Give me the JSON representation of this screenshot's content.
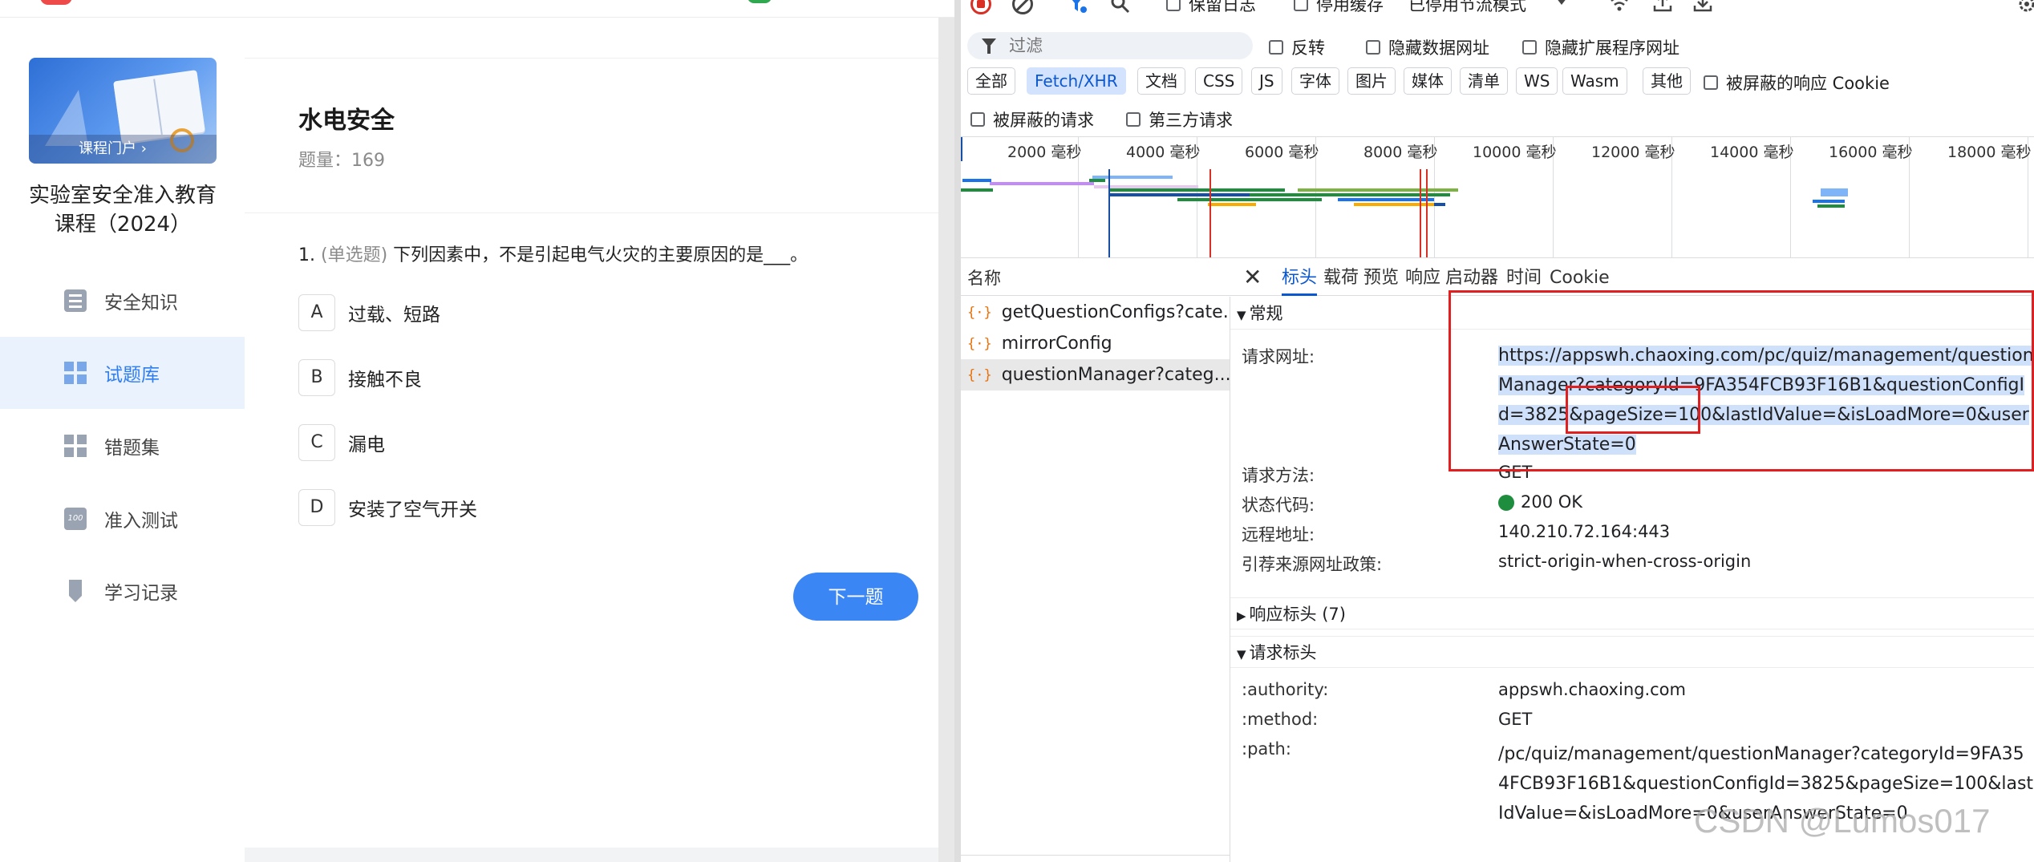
{
  "app": {
    "banner_label": "课程门户 ›",
    "course_title": "实验室安全准入教育课程（2024）",
    "nav": [
      {
        "label": "安全知识",
        "icon": "list-icon"
      },
      {
        "label": "试题库",
        "icon": "grid-icon"
      },
      {
        "label": "错题集",
        "icon": "grid-icon"
      },
      {
        "label": "准入测试",
        "icon": "score-icon"
      },
      {
        "label": "学习记录",
        "icon": "record-icon"
      }
    ],
    "active_nav": "试题库",
    "bank_title": "水电安全",
    "count_label": "题量：",
    "count_value": "169",
    "question": {
      "number": "1.",
      "type": "(单选题)",
      "text": "下列因素中，不是引起电气火灾的主要原因的是___。"
    },
    "options": [
      {
        "letter": "A",
        "text": "过载、短路"
      },
      {
        "letter": "B",
        "text": "接触不良"
      },
      {
        "letter": "C",
        "text": "漏电"
      },
      {
        "letter": "D",
        "text": "安装了空气开关"
      }
    ],
    "next_label": "下一题",
    "accent": "#3a86f5"
  },
  "devtools": {
    "toolbar": {
      "preserve_log": "保留日志",
      "disable_cache": "停用缓存",
      "throttle": "已停用节流模式"
    },
    "filter": {
      "placeholder": "过滤",
      "invert": "反转",
      "hide_data_urls": "隐藏数据网址",
      "hide_ext_urls": "隐藏扩展程序网址"
    },
    "types": [
      "全部",
      "Fetch/XHR",
      "文档",
      "CSS",
      "JS",
      "字体",
      "图片",
      "媒体",
      "清单",
      "WS",
      "Wasm",
      "其他"
    ],
    "active_type": "Fetch/XHR",
    "blocked_cookie": "被屏蔽的响应 Cookie",
    "blocked_requests": "被屏蔽的请求",
    "third_party": "第三方请求",
    "timeline_ticks": [
      "2000 毫秒",
      "4000 毫秒",
      "6000 毫秒",
      "8000 毫秒",
      "10000 毫秒",
      "12000 毫秒",
      "14000 毫秒",
      "16000 毫秒",
      "18000 毫秒"
    ],
    "name_header": "名称",
    "requests": [
      {
        "name": "getQuestionConfigs?cate...",
        "selected": false
      },
      {
        "name": "mirrorConfig",
        "selected": false
      },
      {
        "name": "questionManager?categ...",
        "selected": true
      }
    ],
    "detail_tabs": [
      "标头",
      "载荷",
      "预览",
      "响应",
      "启动器",
      "时间",
      "Cookie"
    ],
    "active_detail_tab": "标头",
    "general": {
      "title": "常规",
      "url_label": "请求网址:",
      "url": "https://appswh.chaoxing.com/pc/quiz/management/questionManager?categoryId=9FA354FCB93F16B1&questionConfigId=3825&pageSize=100&lastIdValue=&isLoadMore=0&userAnswerState=0",
      "method_label": "请求方法:",
      "method": "GET",
      "status_label": "状态代码:",
      "status": "200 OK",
      "status_color": "#1e8e3e",
      "remote_label": "远程地址:",
      "remote": "140.210.72.164:443",
      "referrer_label": "引荐来源网址政策:",
      "referrer": "strict-origin-when-cross-origin"
    },
    "response_headers": "响应标头 (7)",
    "request_headers": {
      "title": "请求标头",
      "authority_label": ":authority:",
      "authority": "appswh.chaoxing.com",
      "method_label": ":method:",
      "method": "GET",
      "path_label": ":path:",
      "path": "/pc/quiz/management/questionManager?categoryId=9FA354FCB93F16B1&questionConfigId=3825&pageSize=100&lastIdValue=&isLoadMore=0&userAnswerState=0"
    },
    "highlight_color": "#e02020"
  },
  "watermark": "CSDN @Lumos017"
}
